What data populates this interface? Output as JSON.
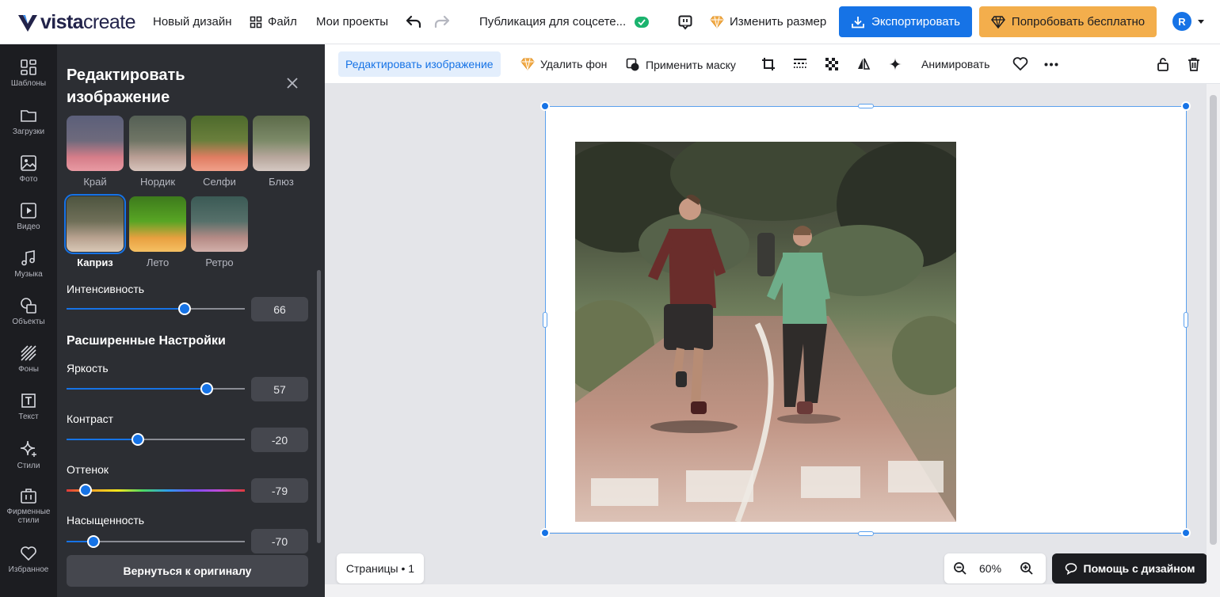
{
  "topbar": {
    "logo_bold": "vista",
    "logo_light": "create",
    "new_design": "Новый дизайн",
    "file": "Файл",
    "my_projects": "Мои проекты",
    "doc_title": "Публикация для соцсете...",
    "resize": "Изменить размер",
    "export": "Экспортировать",
    "try_free": "Попробовать бесплатно",
    "avatar_initial": "R",
    "accent_color": "#1673e6",
    "try_color": "#f3ae4c"
  },
  "rail": [
    {
      "label": "Шаблоны",
      "icon": "templates-icon"
    },
    {
      "label": "Загрузки",
      "icon": "folder-icon"
    },
    {
      "label": "Фото",
      "icon": "photo-icon"
    },
    {
      "label": "Видео",
      "icon": "video-icon"
    },
    {
      "label": "Музыка",
      "icon": "music-icon"
    },
    {
      "label": "Объекты",
      "icon": "objects-icon"
    },
    {
      "label": "Фоны",
      "icon": "backgrounds-icon"
    },
    {
      "label": "Текст",
      "icon": "text-icon"
    },
    {
      "label": "Стили",
      "icon": "styles-icon"
    },
    {
      "label": "Фирменные стили",
      "icon": "brand-icon"
    },
    {
      "label": "Избранное",
      "icon": "heart-icon"
    }
  ],
  "panel": {
    "title": "Редактировать изображение",
    "filters": [
      "Край",
      "Нордик",
      "Селфи",
      "Блюз",
      "Каприз",
      "Лето",
      "Ретро"
    ],
    "active_filter": "Каприз",
    "intensity_label": "Интенсивность",
    "intensity": 66,
    "advanced_title": "Расширенные Настройки",
    "brightness_label": "Яркость",
    "brightness": 57,
    "contrast_label": "Контраст",
    "contrast": -20,
    "hue_label": "Оттенок",
    "hue": -79,
    "saturation_label": "Насыщенность",
    "saturation": -70,
    "reset": "Вернуться к оригиналу"
  },
  "toolbar": {
    "edit_image": "Редактировать изображение",
    "remove_bg": "Удалить фон",
    "apply_mask": "Применить маску",
    "animate": "Анимировать"
  },
  "canvas": {
    "pages": "Страницы • 1",
    "zoom": "60%",
    "help": "Помощь с дизайном"
  }
}
